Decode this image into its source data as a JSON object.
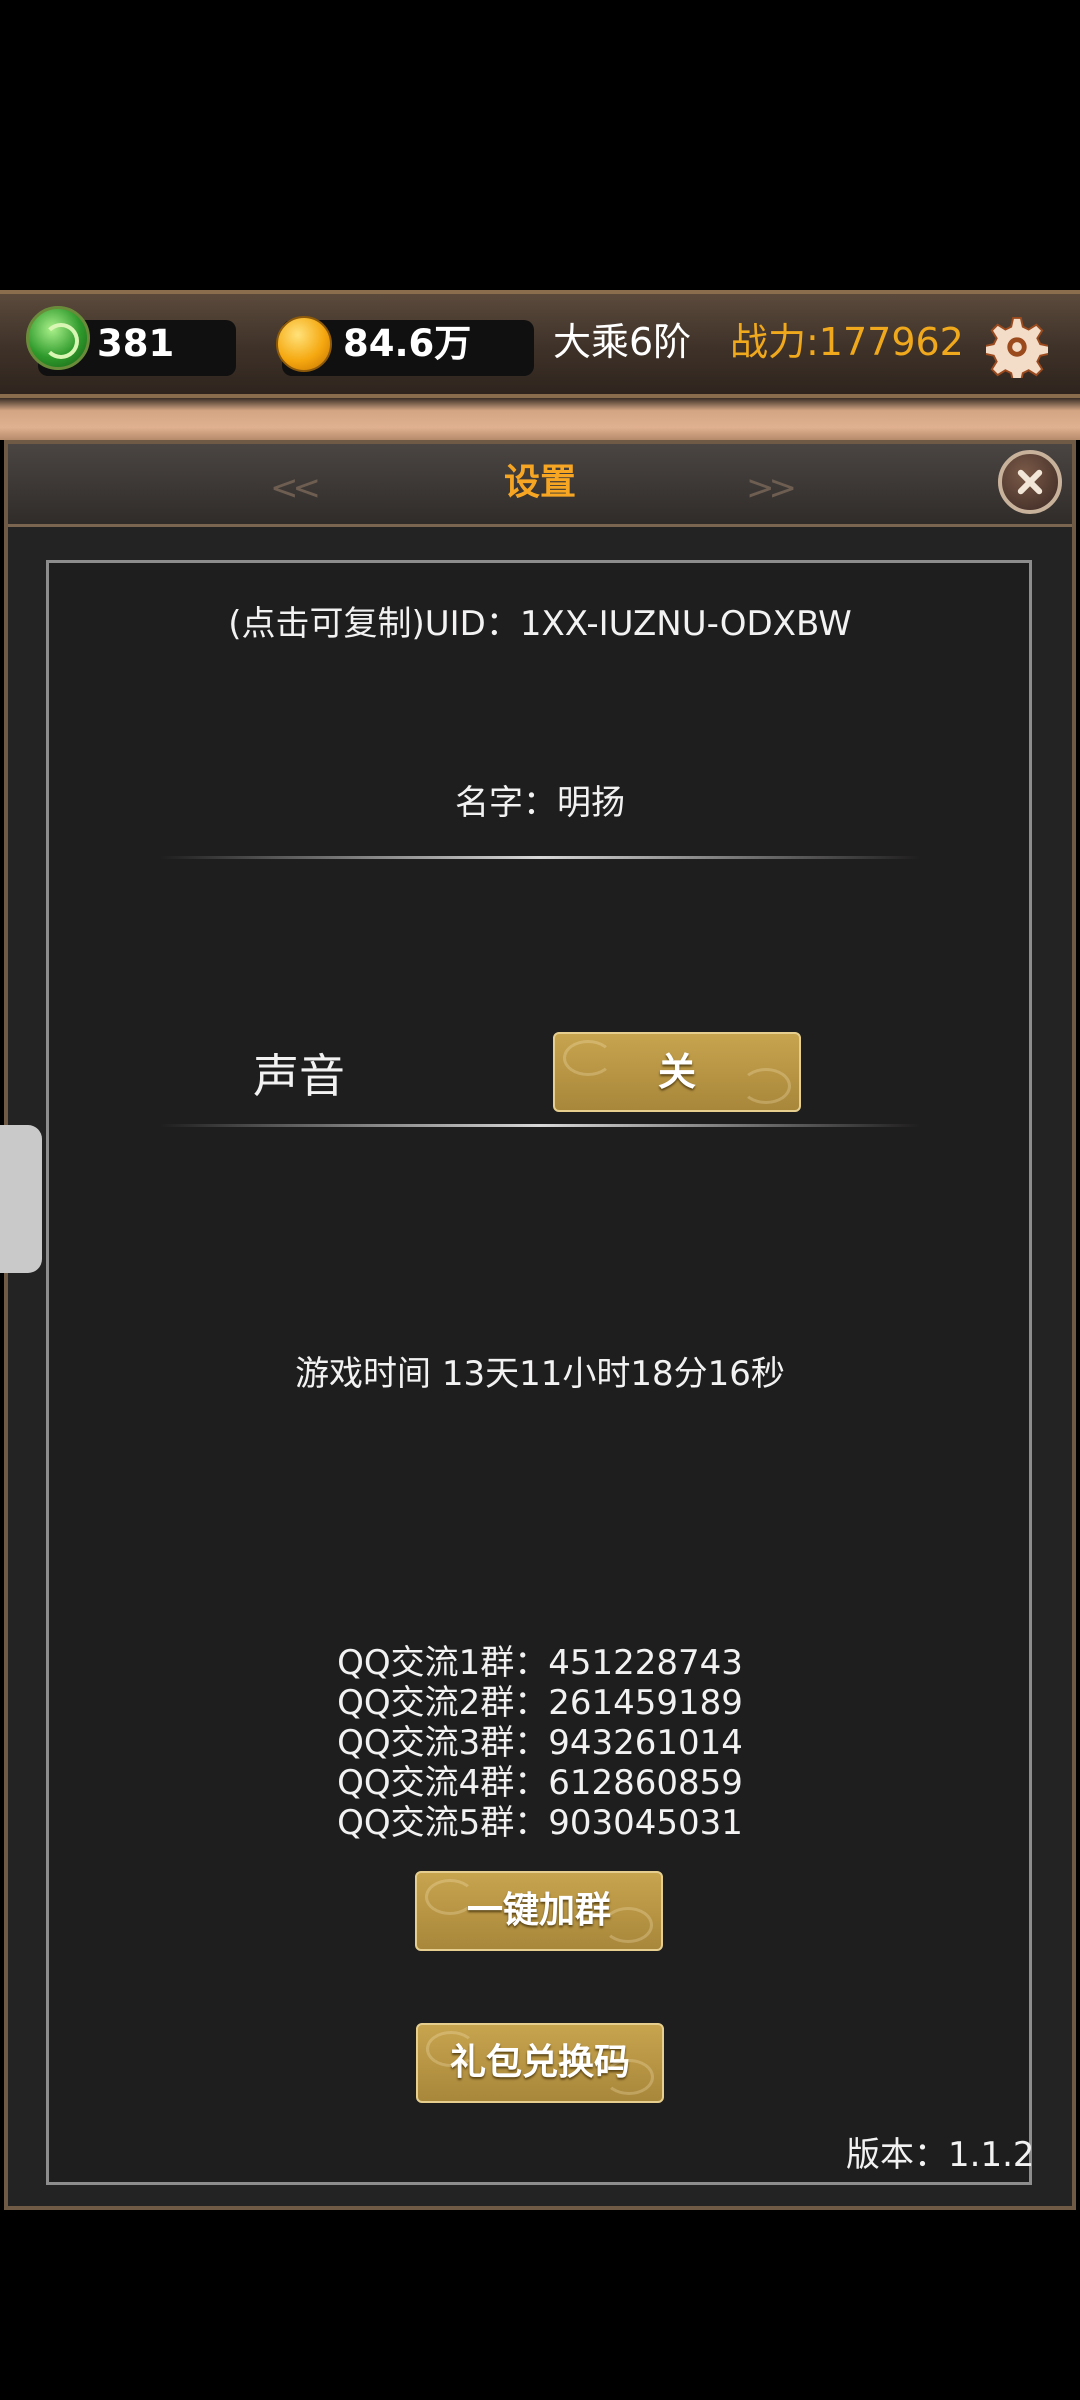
{
  "topbar": {
    "jade_count": "381",
    "gold_amount": "84.6万",
    "realm": "大乘6阶",
    "power": "战力:177962",
    "jade_icon": "jade-icon",
    "coin_icon": "coin-icon",
    "settings_icon": "gear-icon"
  },
  "dialog": {
    "title": "设置",
    "left_deco": "<<",
    "right_deco": ">>",
    "close_icon": "close-icon"
  },
  "settings": {
    "uid_line": "(点击可复制)UID：1XX-IUZNU-ODXBW",
    "name_line": "名字：明扬",
    "sound_label": "声音",
    "sound_toggle": "关",
    "play_time": "游戏时间 13天11小时18分16秒",
    "qq_groups": [
      "QQ交流1群：451228743",
      "QQ交流2群：261459189",
      "QQ交流3群：943261014",
      "QQ交流4群：612860859",
      "QQ交流5群：903045031"
    ],
    "join_group_button": "一键加群",
    "redeem_button": "礼包兑换码",
    "version": "版本：1.1.2"
  },
  "colors": {
    "accent_gold": "#f6a623",
    "power_color": "#f0a81c",
    "button_gold": "#b8953f"
  }
}
